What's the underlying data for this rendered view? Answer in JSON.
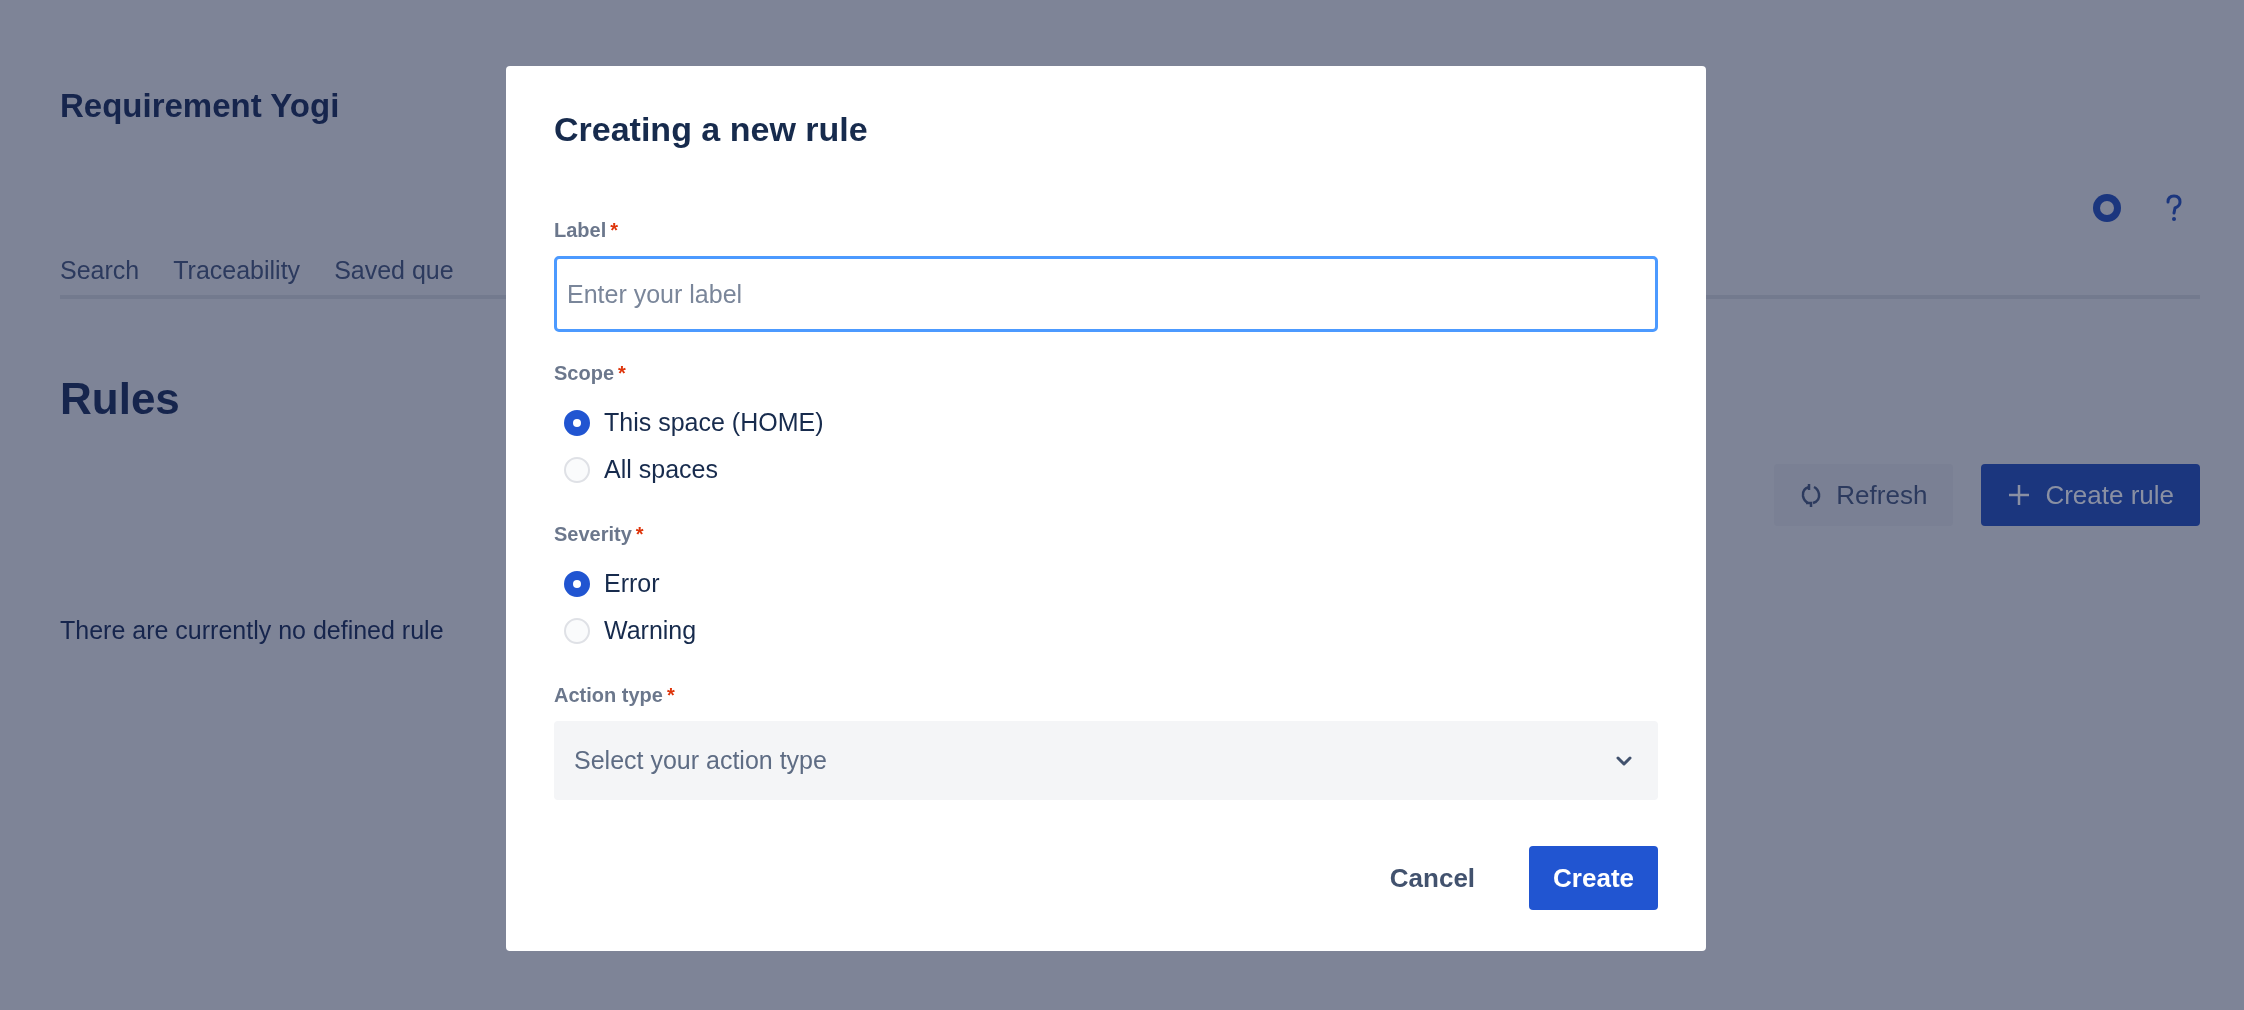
{
  "app": {
    "title": "Requirement Yogi",
    "tabs": [
      {
        "label": "Search"
      },
      {
        "label": "Traceability"
      },
      {
        "label": "Saved que"
      }
    ],
    "page_heading": "Rules",
    "toolbar": [
      {
        "label": "Refresh",
        "kind": "secondary"
      },
      {
        "label": "Create rule",
        "kind": "primary"
      }
    ],
    "empty_message": "There are currently no defined rule"
  },
  "dialog": {
    "title": "Creating a new rule",
    "fields": [
      {
        "kind": "text",
        "label": "Label",
        "required_mark": "*",
        "placeholder": "Enter your label"
      },
      {
        "kind": "radio",
        "label": "Scope",
        "required_mark": "*",
        "options": [
          {
            "label": "This space (HOME)",
            "selected": true
          },
          {
            "label": "All spaces",
            "selected": false
          }
        ]
      },
      {
        "kind": "radio",
        "label": "Severity",
        "required_mark": "*",
        "options": [
          {
            "label": "Error",
            "selected": true
          },
          {
            "label": "Warning",
            "selected": false
          }
        ]
      },
      {
        "kind": "select",
        "label": "Action type",
        "required_mark": "*",
        "placeholder": "Select your action type"
      }
    ],
    "buttons": [
      {
        "label": "Cancel",
        "kind": "subtle"
      },
      {
        "label": "Create",
        "kind": "primary"
      }
    ]
  }
}
